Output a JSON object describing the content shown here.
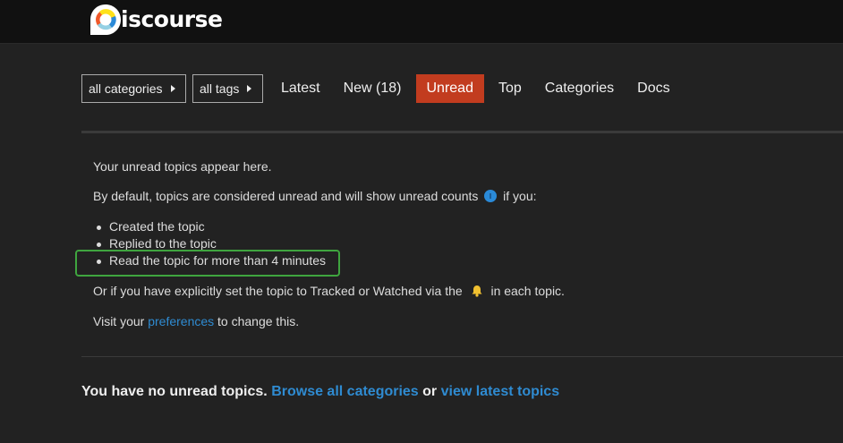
{
  "header": {
    "logo_text": "iscourse",
    "logo_letter": "D"
  },
  "navbar": {
    "category_dropdown": "all categories",
    "tag_dropdown": "all tags",
    "items": [
      {
        "label": "Latest",
        "active": false
      },
      {
        "label": "New (18)",
        "active": false
      },
      {
        "label": "Unread",
        "active": true
      },
      {
        "label": "Top",
        "active": false
      },
      {
        "label": "Categories",
        "active": false
      },
      {
        "label": "Docs",
        "active": false
      }
    ]
  },
  "education": {
    "line1": "Your unread topics appear here.",
    "line2_before": "By default, topics are considered unread and will show unread counts",
    "line2_after": "if you:",
    "bullets": [
      "Created the topic",
      "Replied to the topic",
      "Read the topic for more than 4 minutes"
    ],
    "line3_before": "Or if you have explicitly set the topic to Tracked or Watched via the",
    "line3_after": "in each topic.",
    "line4_before": "Visit your",
    "line4_link": "preferences",
    "line4_after": "to change this."
  },
  "footer": {
    "message": "You have no unread topics.",
    "browse_link": "Browse all categories",
    "or_text": "or",
    "latest_link": "view latest topics"
  },
  "colors": {
    "background": "#222222",
    "header": "#111111",
    "active_tab": "#c23c1f",
    "link": "#2f8bd1",
    "highlight": "#3fa53f"
  },
  "icons": {
    "info": "info-icon",
    "bell": "bell-icon",
    "caret": "caret-right-icon"
  }
}
